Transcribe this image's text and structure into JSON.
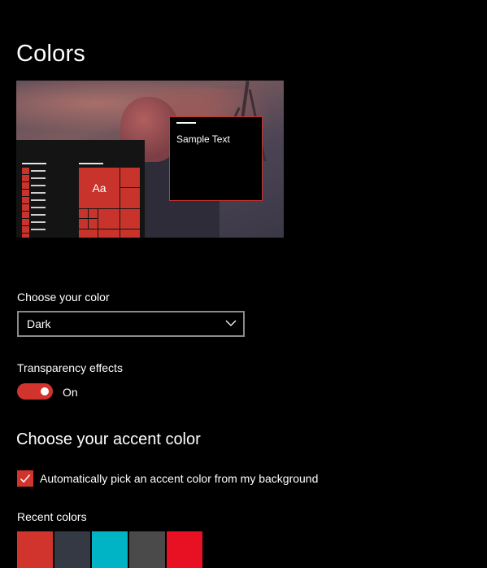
{
  "header": {
    "title": "Colors"
  },
  "preview": {
    "sample_text": "Sample Text",
    "tile_text": "Aa"
  },
  "color_mode": {
    "label": "Choose your color",
    "selected": "Dark"
  },
  "transparency": {
    "label": "Transparency effects",
    "state": "On",
    "enabled": true
  },
  "accent": {
    "title": "Choose your accent color",
    "auto_pick_label": "Automatically pick an accent color from my background",
    "auto_pick_checked": true,
    "recent_label": "Recent colors",
    "recent_colors": [
      "#d0342c",
      "#343944",
      "#00b4c5",
      "#4a4a4a",
      "#e81123"
    ]
  },
  "colors": {
    "accent": "#d0342c",
    "background": "#000000"
  }
}
